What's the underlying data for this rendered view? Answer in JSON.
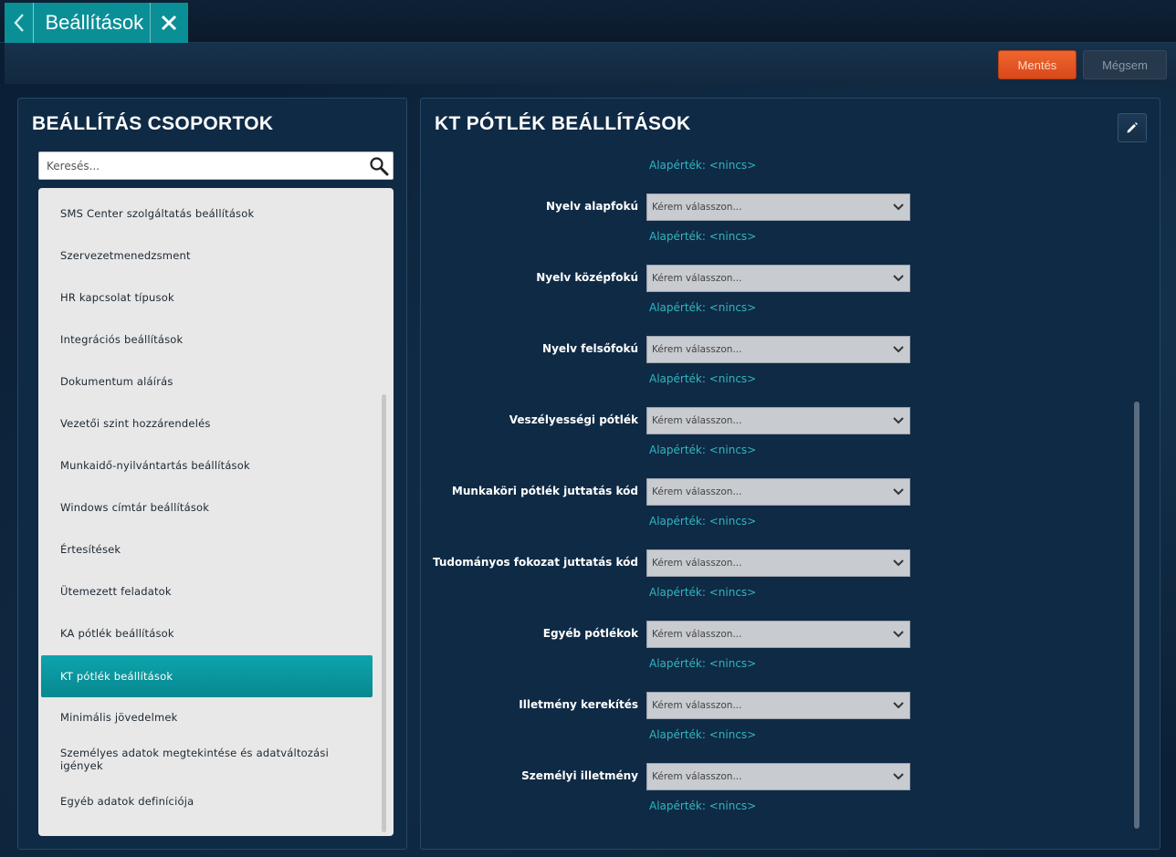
{
  "tab": {
    "title": "Beállítások"
  },
  "toolbar": {
    "save_label": "Mentés",
    "cancel_label": "Mégsem"
  },
  "left_panel": {
    "title": "BEÁLLÍTÁS CSOPORTOK",
    "search_placeholder": "Keresés...",
    "items": [
      "SMS Center szolgáltatás beállítások",
      "Szervezetmenedzsment",
      "HR kapcsolat típusok",
      "Integrációs beállítások",
      "Dokumentum aláírás",
      "Vezetői szint hozzárendelés",
      "Munkaidő-nyilvántartás beállítások",
      "Windows címtár beállítások",
      "Értesítések",
      "Ütemezett feladatok",
      "KA pótlék beállítások",
      "KT pótlék beállítások",
      "Minimális jövedelmek",
      "Személyes adatok megtekintése és adatváltozási igények",
      "Egyéb adatok definíciója"
    ],
    "active_item": "KT pótlék beállítások"
  },
  "right_panel": {
    "title": "KT PÓTLÉK BEÁLLÍTÁSOK",
    "top_default": "Alapérték: <nincs>",
    "select_placeholder": "Kérem válasszon...",
    "fields": [
      {
        "label": "Nyelv alapfokú",
        "default": "Alapérték: <nincs>"
      },
      {
        "label": "Nyelv középfokú",
        "default": "Alapérték: <nincs>"
      },
      {
        "label": "Nyelv felsőfokú",
        "default": "Alapérték: <nincs>"
      },
      {
        "label": "Veszélyességi pótlék",
        "default": "Alapérték: <nincs>"
      },
      {
        "label": "Munkaköri pótlék juttatás kód",
        "default": "Alapérték: <nincs>"
      },
      {
        "label": "Tudományos fokozat juttatás kód",
        "default": "Alapérték: <nincs>"
      },
      {
        "label": "Egyéb pótlékok",
        "default": "Alapérték: <nincs>"
      },
      {
        "label": "Illetmény kerekítés",
        "default": "Alapérték: <nincs>"
      },
      {
        "label": "Személyi illetmény",
        "default": "Alapérték: <nincs>"
      }
    ]
  },
  "icons": {
    "back": "chevron-left-icon",
    "close": "close-icon",
    "search": "search-icon",
    "edit": "pencil-icon",
    "dropdown": "chevron-down-icon"
  },
  "colors": {
    "accent": "#0b8f97",
    "save": "#e85a25",
    "link": "#2fb6c0",
    "panel": "#0f2a45"
  }
}
